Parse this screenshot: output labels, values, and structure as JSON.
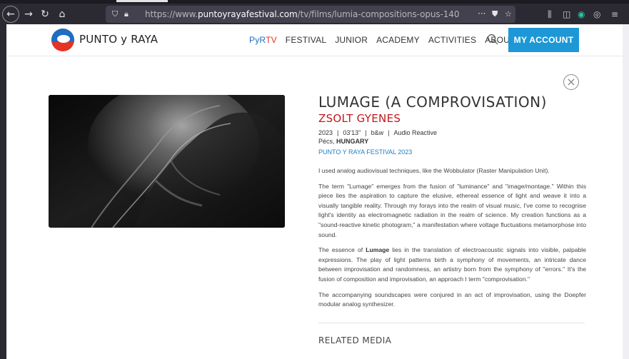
{
  "browser": {
    "url_prefix": "https://www.",
    "url_domain": "puntoyrayafestival.com",
    "url_path": "/tv/films/lumia-compositions-opus-140",
    "more_glyph": "···",
    "icons": [
      "back-arrow",
      "forward-arrow",
      "reload",
      "home",
      "shield",
      "lock",
      "pocket",
      "star",
      "library",
      "sidebar",
      "extension",
      "account",
      "menu"
    ]
  },
  "site": {
    "logo_text": "PUNTO y RAYA",
    "nav": {
      "pyr_prefix": "PyR",
      "pyr_suffix": "TV",
      "festival": "FESTIVAL",
      "junior": "JUNIOR",
      "academy": "ACADEMY",
      "activities": "ACTIVITIES",
      "about": "ABOUT"
    },
    "account_button": "MY ACCOUNT",
    "colors": {
      "red": "#c4161c",
      "blue": "#1e97d6"
    }
  },
  "film": {
    "title": "LUMAGE (A COMPROVISATION)",
    "artist": "ZSOLT GYENES",
    "year": "2023",
    "duration": "03'13\"",
    "color": "b&w",
    "tag": "Audio Reactive",
    "city": "Pécs,",
    "country": "HUNGARY",
    "festival": "PUNTO Y RAYA FESTIVAL 2023",
    "p1": "I used analog audiovisual techniques, like the Wobbulator (Raster Manipulation Unit).",
    "p2": "The term \"Lumage\" emerges from the fusion of \"luminance\" and \"image/montage.\" Within this piece lies the aspiration to capture the elusive, ethereal essence of light and weave it into a visually tangible reality. Through my forays into the realm of visual music, I've come to recognise light's identity as electromagnetic radiation in the realm of science. My creation functions as a \"sound-reactive kinetic photogram,\" a manifestation where voltage fluctuations metamorphose into sound.",
    "p3_a": "The essence of ",
    "p3_b": "Lumage",
    "p3_c": " lies in the translation of electroacoustic signals into visible, palpable expressions. The play of light patterns birth a symphony of movements, an intricate dance between improvisation and randomness, an artistry born from the symphony of \"errors.\" It's the fusion of composition and improvisation, an approach I term \"comprovisation.\"",
    "p4": "The accompanying soundscapes were conjured in an act of improvisation, using the Doepfer modular analog synthesizer.",
    "related_heading": "RELATED MEDIA"
  }
}
